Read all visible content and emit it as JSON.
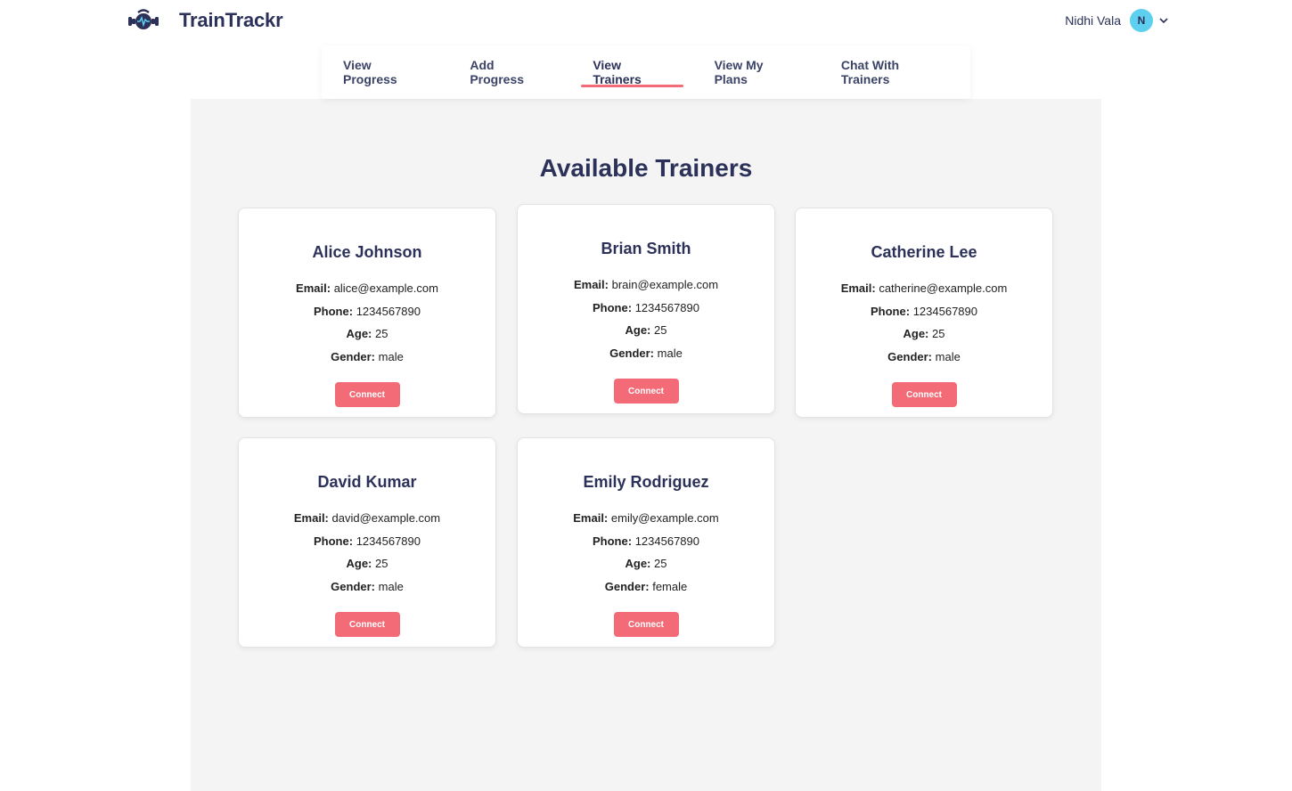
{
  "header": {
    "brand": "TrainTrackr",
    "user_name": "Nidhi Vala",
    "avatar_initial": "N"
  },
  "nav": {
    "items": [
      {
        "label": "View Progress"
      },
      {
        "label": "Add Progress"
      },
      {
        "label": "View Trainers",
        "active": true
      },
      {
        "label": "View My Plans"
      },
      {
        "label": "Chat With Trainers"
      }
    ]
  },
  "main": {
    "title": "Available Trainers"
  },
  "field_labels": {
    "email": "Email:",
    "phone": "Phone:",
    "age": "Age:",
    "gender": "Gender:"
  },
  "trainers": [
    {
      "name": "Alice Johnson",
      "email": "alice@example.com",
      "phone": "1234567890",
      "age": "25",
      "gender": "male",
      "button": "Connect"
    },
    {
      "name": "Brian Smith",
      "email": "brain@example.com",
      "phone": "1234567890",
      "age": "25",
      "gender": "male",
      "button": "Connect"
    },
    {
      "name": "Catherine Lee",
      "email": "catherine@example.com",
      "phone": "1234567890",
      "age": "25",
      "gender": "male",
      "button": "Connect"
    },
    {
      "name": "David Kumar",
      "email": "david@example.com",
      "phone": "1234567890",
      "age": "25",
      "gender": "male",
      "button": "Connect"
    },
    {
      "name": "Emily Rodriguez",
      "email": "emily@example.com",
      "phone": "1234567890",
      "age": "25",
      "gender": "female",
      "button": "Connect"
    }
  ],
  "colors": {
    "accent": "#f36b76",
    "text_primary": "#2b3159",
    "avatar": "#5fcfef",
    "panel_background": "#f4f4f4"
  },
  "icons": {
    "logo": "kettlebell-heartbeat-icon",
    "user_menu": "chevron-down-icon"
  }
}
